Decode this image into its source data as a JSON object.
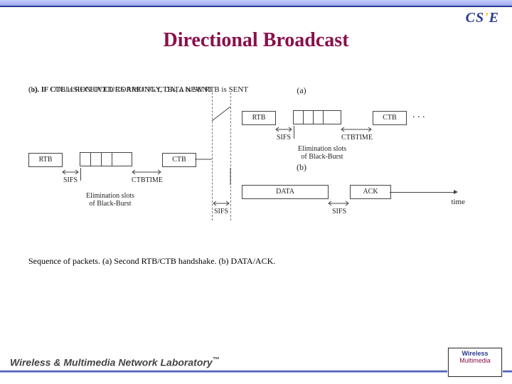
{
  "header": {
    "title": "Directional Broadcast",
    "logo": {
      "c": "CS",
      "s": "'",
      "e": "E"
    }
  },
  "notes": {
    "a": "(a). IF COLLISION OCCURS AMONG CTBs, a NEW RTB is SENT",
    "b": "(b). IF CTB is RECEIVED CORRECTLY, DATA is SENT"
  },
  "caption": "Sequence of packets. (a) Second RTB/CTB handshake. (b) DATA/ACK.",
  "left_timeline": {
    "packets": {
      "rtb": "RTB",
      "ctb": "CTB"
    },
    "gaps": {
      "sifs": "SIFS",
      "ctbtime": "CTBTIME"
    },
    "burst_label": "Elimination slots\nof Black-Burst"
  },
  "branch_a": {
    "marker": "(a)",
    "packets": {
      "rtb": "RTB",
      "ctb": "CTB"
    },
    "gaps": {
      "sifs": "SIFS",
      "ctbtime": "CTBTIME"
    },
    "burst_label": "Elimination slots\nof Black-Burst",
    "dots": ". . ."
  },
  "branch_b": {
    "marker": "(b)",
    "packets": {
      "data": "DATA",
      "ack": "ACK"
    },
    "gaps": {
      "sifs1": "SIFS",
      "sifs2": "SIFS"
    },
    "axis_label": "time"
  },
  "footer": {
    "lab": "Wireless & Multimedia Network Laboratory",
    "tm": "™",
    "wm_top": "Wireless",
    "wm_bottom": "Multimedia"
  }
}
